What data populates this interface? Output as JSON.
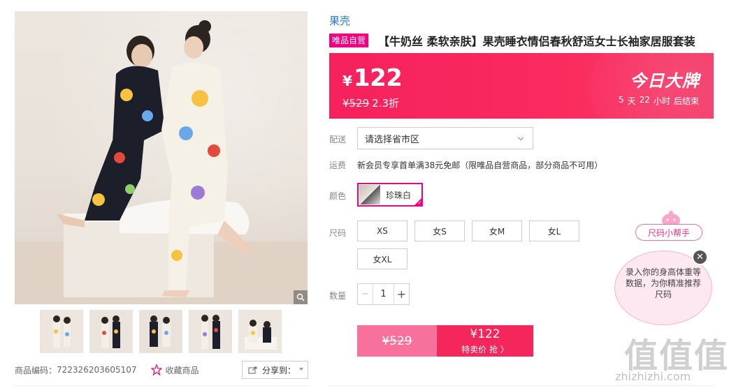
{
  "brand": "果壳",
  "badge": "唯品自营",
  "title": "【牛奶丝 柔软亲肤】果壳睡衣情侣春秋舒适女士长袖家居服套装",
  "price": {
    "currency": "¥",
    "value": "122",
    "original": "¥529",
    "discount": "2.3折",
    "banner_title": "今日大牌",
    "countdown": [
      "5",
      "天",
      "22",
      "小时",
      "后结束"
    ]
  },
  "delivery": {
    "label": "配送",
    "placeholder": "请选择省市区"
  },
  "shipping": {
    "label": "运费",
    "text": "新会员专享首单满38元免邮（限唯品自营商品，部分商品不可用）"
  },
  "color": {
    "label": "颜色",
    "selected": "珍珠白"
  },
  "size": {
    "label": "尺码",
    "options": [
      "XS",
      "女S",
      "女M",
      "女L",
      "女XL"
    ]
  },
  "quantity": {
    "label": "数量",
    "value": "1",
    "minus": "−",
    "plus": "+"
  },
  "buy": {
    "original": "¥529",
    "price": "¥122",
    "action": "特卖价 抢 〉"
  },
  "meta": {
    "sku_label": "商品编码：",
    "sku_value": "722326203605107",
    "favorite": "收藏商品",
    "share": "分享到："
  },
  "helper": {
    "tab": "尺码小帮手",
    "text": "录入你的身高体重等数据，为你精准推荐尺码",
    "close": "✕"
  },
  "watermark": {
    "logo": "值值值",
    "url": "zhizhizhi.com"
  },
  "colors": {
    "accent": "#f10180",
    "banner": "#f6215d",
    "brand_link": "#2a7ad2"
  }
}
